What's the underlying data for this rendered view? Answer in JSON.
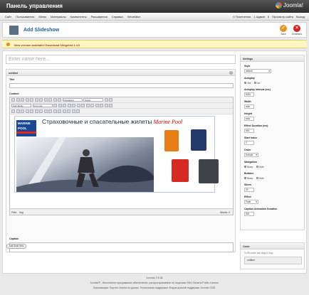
{
  "header": {
    "title": "Панель управления",
    "logo": "Joomla!"
  },
  "menu": [
    "Сайт",
    "Пользователи",
    "Меню",
    "Материалы",
    "Компоненты",
    "Расширения",
    "Справка",
    "VirtueMart"
  ],
  "stats": [
    "0 Посетители",
    "1 Админ",
    "0",
    "Просмотр сайта",
    "Выход"
  ],
  "toolbar": {
    "title": "Add Slideshow",
    "save": "Save",
    "cancel": "Отменить",
    "save_color": "#e8931a",
    "cancel_color": "#d0231e"
  },
  "notice": {
    "text": "New version available! Download Slidgetist 1.4.0"
  },
  "name_field": {
    "placeholder": "Enter name here..."
  },
  "slide": {
    "header": "untitled",
    "title_label": "Title",
    "content_label": "Content",
    "caption_label": "Caption",
    "add_button": "Add Slide Item"
  },
  "editor": {
    "paragraph_select": "Paragraph",
    "styles_select": "Styles",
    "font_family_select": "Font family",
    "font_size_select": "Font size",
    "path_label": "Path:",
    "path_value": "img",
    "words_label": "Words: 0"
  },
  "banner": {
    "brand_top": "MARINE",
    "brand_bottom": "POOL",
    "headline": "Страховочные и спасательные жилеты",
    "headline_brand": "Marine Pool"
  },
  "settings": {
    "title": "Settings",
    "style_label": "Style",
    "style_value": "default",
    "autoplay_label": "Autoplay",
    "autoplay_yes": "Yes",
    "autoplay_no": "No",
    "interval_label": "Autoplay Interval (ms)",
    "interval_value": "5000",
    "width_label": "Width",
    "width_value": "auto",
    "height_label": "Height",
    "height_value": "auto",
    "duration_label": "Effect Duration (ms)",
    "duration_value": "800",
    "start_label": "Start Index",
    "start_value": "0",
    "order_label": "Order",
    "order_value": "Default",
    "nav_label": "Navigation",
    "nav_show": "Show",
    "nav_hide": "Hide",
    "buttons_label": "Buttons",
    "buttons_show": "Show",
    "buttons_hide": "Hide",
    "slices_label": "Slices",
    "slices_value": "20",
    "effect_label": "Effect",
    "effect_value": "Fade",
    "caption_anim_label": "Caption Animation Duration",
    "caption_anim_value": "800"
  },
  "order_panel": {
    "title": "Order",
    "hint": "To Re-order use drag & drop",
    "item": "untitled"
  },
  "footer": {
    "version": "Joomla! 2.5.28",
    "line1": "Joomla!® - бесплатное программное обеспечение, распространяемое по лицензии GNU General Public License.",
    "line2": "Локализация: Портал Joomla по-русски. Техническая поддержка: Форум русской поддержки Joomla! CMS."
  }
}
